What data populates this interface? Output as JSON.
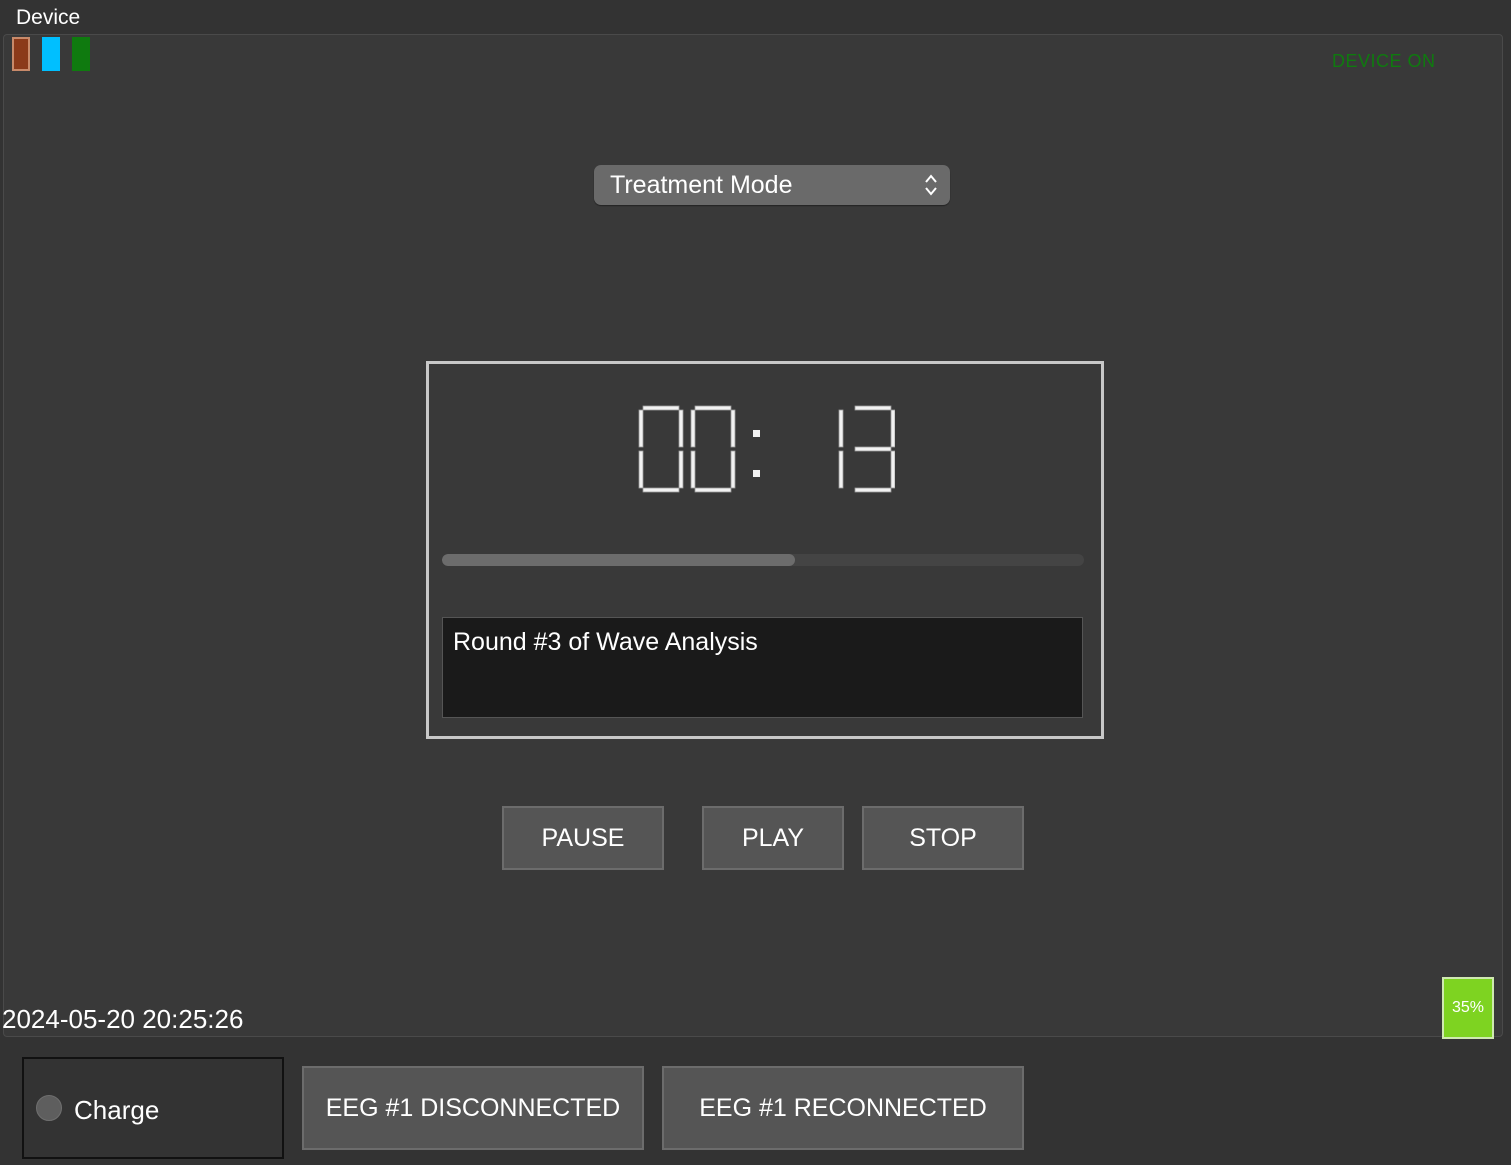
{
  "window": {
    "title": "Device"
  },
  "indicators": {
    "leds": [
      {
        "name": "brown",
        "color": "#8b3a1a"
      },
      {
        "name": "cyan",
        "color": "#00bfff"
      },
      {
        "name": "green",
        "color": "#0f7a0f"
      }
    ],
    "device_status": "DEVICE ON",
    "device_status_color": "#0f7a0f"
  },
  "mode_select": {
    "selected": "Treatment Mode",
    "icon": "up-down-chevron-icon"
  },
  "timer": {
    "display": "00:13",
    "progress_fraction": 0.55,
    "status_text": "Round #3 of Wave Analysis"
  },
  "controls": {
    "pause": "PAUSE",
    "play": "PLAY",
    "stop": "STOP"
  },
  "footer": {
    "datetime": "2024-05-20 20:25:26",
    "battery": "35%",
    "battery_color": "#7ed321"
  },
  "bottom_bar": {
    "charge_label": "Charge",
    "eeg_disconnected": "EEG #1 DISCONNECTED",
    "eeg_reconnected": "EEG #1 RECONNECTED"
  }
}
